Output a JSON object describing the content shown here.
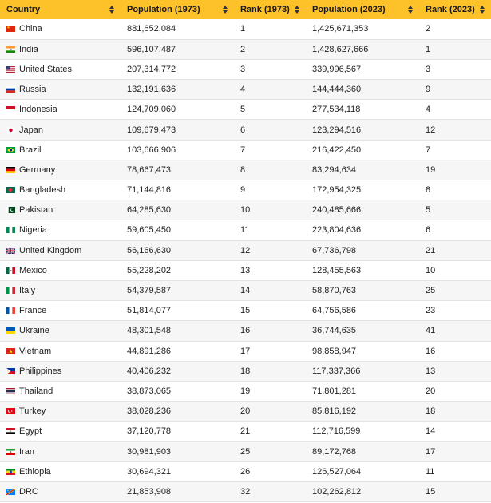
{
  "header": {
    "country": "Country",
    "pop1973": "Population (1973)",
    "rank1973": "Rank (1973)",
    "pop2023": "Population (2023)",
    "rank2023": "Rank (2023)"
  },
  "rows": [
    {
      "country": "China",
      "flag": "china-flag-icon",
      "pop1973": "881,652,084",
      "rank1973": "1",
      "pop2023": "1,425,671,353",
      "rank2023": "2"
    },
    {
      "country": "India",
      "flag": "india-flag-icon",
      "pop1973": "596,107,487",
      "rank1973": "2",
      "pop2023": "1,428,627,666",
      "rank2023": "1"
    },
    {
      "country": "United States",
      "flag": "us-flag-icon",
      "pop1973": "207,314,772",
      "rank1973": "3",
      "pop2023": "339,996,567",
      "rank2023": "3"
    },
    {
      "country": "Russia",
      "flag": "russia-flag-icon",
      "pop1973": "132,191,636",
      "rank1973": "4",
      "pop2023": "144,444,360",
      "rank2023": "9"
    },
    {
      "country": "Indonesia",
      "flag": "indonesia-flag-icon",
      "pop1973": "124,709,060",
      "rank1973": "5",
      "pop2023": "277,534,118",
      "rank2023": "4"
    },
    {
      "country": "Japan",
      "flag": "japan-flag-icon",
      "pop1973": "109,679,473",
      "rank1973": "6",
      "pop2023": "123,294,516",
      "rank2023": "12"
    },
    {
      "country": "Brazil",
      "flag": "brazil-flag-icon",
      "pop1973": "103,666,906",
      "rank1973": "7",
      "pop2023": "216,422,450",
      "rank2023": "7"
    },
    {
      "country": "Germany",
      "flag": "germany-flag-icon",
      "pop1973": "78,667,473",
      "rank1973": "8",
      "pop2023": "83,294,634",
      "rank2023": "19"
    },
    {
      "country": "Bangladesh",
      "flag": "bangladesh-flag-icon",
      "pop1973": "71,144,816",
      "rank1973": "9",
      "pop2023": "172,954,325",
      "rank2023": "8"
    },
    {
      "country": "Pakistan",
      "flag": "pakistan-flag-icon",
      "pop1973": "64,285,630",
      "rank1973": "10",
      "pop2023": "240,485,666",
      "rank2023": "5"
    },
    {
      "country": "Nigeria",
      "flag": "nigeria-flag-icon",
      "pop1973": "59,605,450",
      "rank1973": "11",
      "pop2023": "223,804,636",
      "rank2023": "6"
    },
    {
      "country": "United Kingdom",
      "flag": "uk-flag-icon",
      "pop1973": "56,166,630",
      "rank1973": "12",
      "pop2023": "67,736,798",
      "rank2023": "21"
    },
    {
      "country": "Mexico",
      "flag": "mexico-flag-icon",
      "pop1973": "55,228,202",
      "rank1973": "13",
      "pop2023": "128,455,563",
      "rank2023": "10"
    },
    {
      "country": "Italy",
      "flag": "italy-flag-icon",
      "pop1973": "54,379,587",
      "rank1973": "14",
      "pop2023": "58,870,763",
      "rank2023": "25"
    },
    {
      "country": "France",
      "flag": "france-flag-icon",
      "pop1973": "51,814,077",
      "rank1973": "15",
      "pop2023": "64,756,586",
      "rank2023": "23"
    },
    {
      "country": "Ukraine",
      "flag": "ukraine-flag-icon",
      "pop1973": "48,301,548",
      "rank1973": "16",
      "pop2023": "36,744,635",
      "rank2023": "41"
    },
    {
      "country": "Vietnam",
      "flag": "vietnam-flag-icon",
      "pop1973": "44,891,286",
      "rank1973": "17",
      "pop2023": "98,858,947",
      "rank2023": "16"
    },
    {
      "country": "Philippines",
      "flag": "philippines-flag-icon",
      "pop1973": "40,406,232",
      "rank1973": "18",
      "pop2023": "117,337,366",
      "rank2023": "13"
    },
    {
      "country": "Thailand",
      "flag": "thailand-flag-icon",
      "pop1973": "38,873,065",
      "rank1973": "19",
      "pop2023": "71,801,281",
      "rank2023": "20"
    },
    {
      "country": "Turkey",
      "flag": "turkey-flag-icon",
      "pop1973": "38,028,236",
      "rank1973": "20",
      "pop2023": "85,816,192",
      "rank2023": "18"
    },
    {
      "country": "Egypt",
      "flag": "egypt-flag-icon",
      "pop1973": "37,120,778",
      "rank1973": "21",
      "pop2023": "112,716,599",
      "rank2023": "14"
    },
    {
      "country": "Iran",
      "flag": "iran-flag-icon",
      "pop1973": "30,981,903",
      "rank1973": "25",
      "pop2023": "89,172,768",
      "rank2023": "17"
    },
    {
      "country": "Ethiopia",
      "flag": "ethiopia-flag-icon",
      "pop1973": "30,694,321",
      "rank1973": "26",
      "pop2023": "126,527,064",
      "rank2023": "11"
    },
    {
      "country": "DRC",
      "flag": "drc-flag-icon",
      "pop1973": "21,853,908",
      "rank1973": "32",
      "pop2023": "102,262,812",
      "rank2023": "15"
    }
  ],
  "colors": {
    "header_bg": "#fdc12a",
    "row_alt_bg": "#f6f6f6"
  }
}
